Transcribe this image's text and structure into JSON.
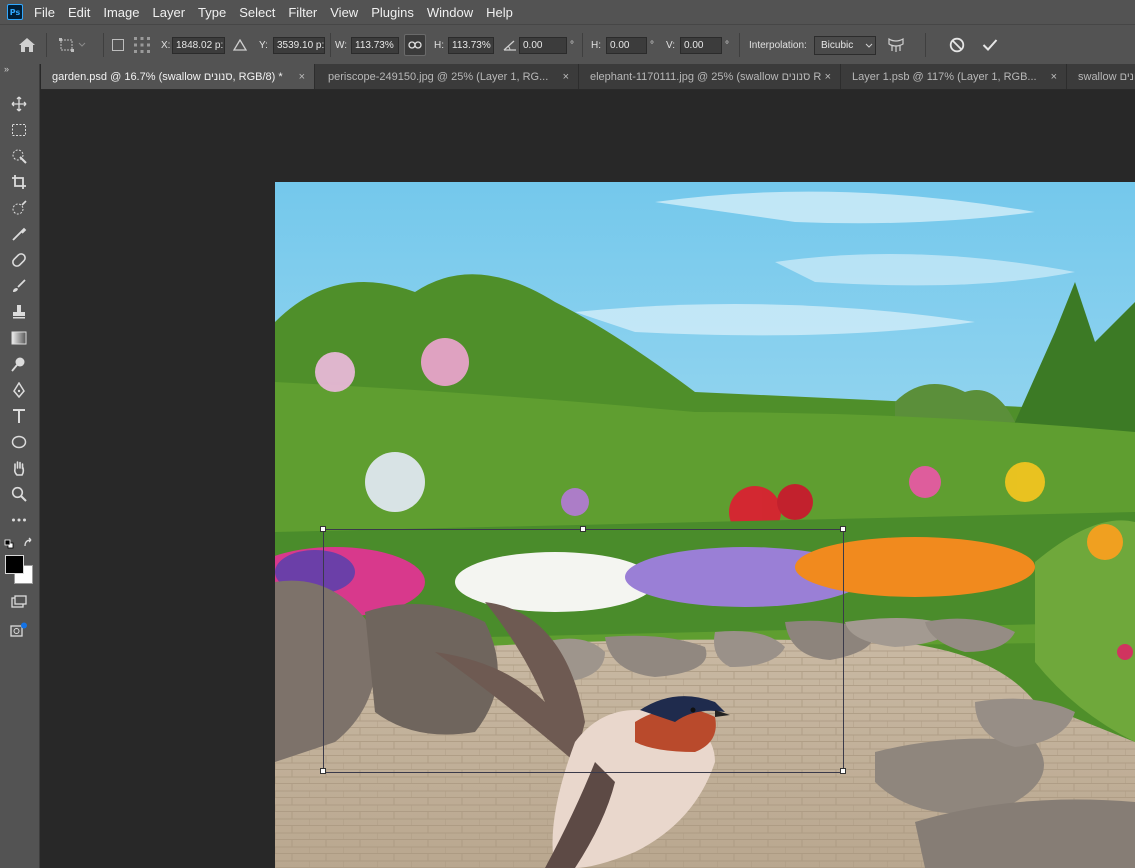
{
  "app": {
    "logo_text": "Ps"
  },
  "menu": [
    "File",
    "Edit",
    "Image",
    "Layer",
    "Type",
    "Select",
    "Filter",
    "View",
    "Plugins",
    "Window",
    "Help"
  ],
  "options": {
    "x_label": "X:",
    "x_value": "1848.02 p:",
    "y_label": "Y:",
    "y_value": "3539.10 p:",
    "w_label": "W:",
    "w_value": "113.73%",
    "h_label": "H:",
    "h_value": "113.73%",
    "rotate_value": "0.00",
    "degree": "°",
    "hskew_label": "H:",
    "hskew_value": "0.00",
    "vskew_label": "V:",
    "vskew_value": "0.00",
    "interpolation_label": "Interpolation:",
    "interpolation_value": "Bicubic"
  },
  "tabs": [
    {
      "title": "garden.psd @ 16.7% (swallow סנונים, RGB/8) *",
      "close": "×"
    },
    {
      "title": "periscope-249150.jpg @ 25% (Layer 1, RG...",
      "close": "×"
    },
    {
      "title": "elephant-1170111.jpg @ 25% (swallow סנונים R",
      "close": "×"
    },
    {
      "title": "Layer 1.psb @ 117% (Layer 1, RGB...",
      "close": "×"
    },
    {
      "title": "swallow סנונים",
      "close": ""
    }
  ],
  "tools": [
    "move-icon",
    "marquee-icon",
    "quick-select-icon",
    "crop-icon",
    "frame-icon",
    "eyedropper-icon",
    "healing-icon",
    "brush-icon",
    "stamp-icon",
    "gradient-icon",
    "dodge-icon",
    "pen-icon",
    "type-icon",
    "ellipse-icon",
    "hand-icon",
    "zoom-icon",
    "more-icon"
  ],
  "colors": {
    "foreground": "#000000",
    "background": "#ffffff",
    "ui_panel": "#535353",
    "canvas_bg": "#282828"
  }
}
